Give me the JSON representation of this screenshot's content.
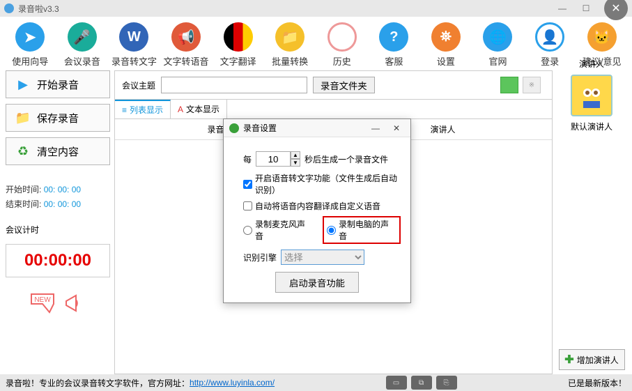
{
  "window": {
    "title": "录音啦v3.3"
  },
  "toolbar": [
    {
      "label": "使用向导",
      "color": "c-blue",
      "glyph": "➤"
    },
    {
      "label": "会议录音",
      "color": "c-teal",
      "glyph": "🎤"
    },
    {
      "label": "录音转文字",
      "color": "c-dblue",
      "glyph": "W"
    },
    {
      "label": "文字转语音",
      "color": "c-red",
      "glyph": "📢"
    },
    {
      "label": "文字翻译",
      "color": "c-flag",
      "glyph": ""
    },
    {
      "label": "批量转换",
      "color": "c-yel",
      "glyph": "📁"
    },
    {
      "label": "历史",
      "color": "c-clock",
      "glyph": "↺"
    },
    {
      "label": "客服",
      "color": "c-q",
      "glyph": "?"
    },
    {
      "label": "设置",
      "color": "c-life",
      "glyph": "⛯"
    },
    {
      "label": "官网",
      "color": "c-globe",
      "glyph": "🌐"
    },
    {
      "label": "登录",
      "color": "c-user",
      "glyph": "👤"
    },
    {
      "label": "建议/意见",
      "color": "c-cat",
      "glyph": "🐱"
    }
  ],
  "left": {
    "buttons": [
      {
        "label": "开始录音",
        "icon": "▶",
        "bg": "#2aa0ea"
      },
      {
        "label": "保存录音",
        "icon": "📁",
        "bg": "#f5c02a"
      },
      {
        "label": "清空内容",
        "icon": "♻",
        "bg": "#3aa03a"
      }
    ],
    "start_label": "开始时间:",
    "start_value": "00: 00: 00",
    "end_label": "结束时间:",
    "end_value": "00: 00: 00",
    "meter_label": "会议计时",
    "meter_value": "00:00:00",
    "new_badge": "NEW"
  },
  "mid": {
    "topic_label": "会议主题",
    "topic_value": "",
    "folder_btn": "录音文件夹",
    "sw2_text": "※",
    "tabs": [
      {
        "icon": "≡",
        "label": "列表显示"
      },
      {
        "icon": "A",
        "label": "文本显示"
      }
    ],
    "cols": [
      "录音时间",
      "演讲人"
    ]
  },
  "right": {
    "section_label": "演讲人",
    "default_speaker": "默认演讲人",
    "add_btn": "增加演讲人"
  },
  "dialog": {
    "title": "录音设置",
    "every": "每",
    "seconds_value": "10",
    "after_text": "秒后生成一个录音文件",
    "chk1": "开启语音转文字功能（文件生成后自动识别）",
    "chk1_checked": true,
    "chk2": "自动将语音内容翻译成自定义语音",
    "chk2_checked": false,
    "radio1": "录制麦克风声音",
    "radio2": "录制电脑的声音",
    "radio_selected": 2,
    "engine_label": "识别引擎",
    "engine_value": "选择",
    "start_btn": "启动录音功能"
  },
  "status": {
    "left": "录音啦！专业的会议录音转文字软件，官方网址：",
    "link": "http://www.luyinla.com/",
    "right": "已是最新版本！"
  }
}
